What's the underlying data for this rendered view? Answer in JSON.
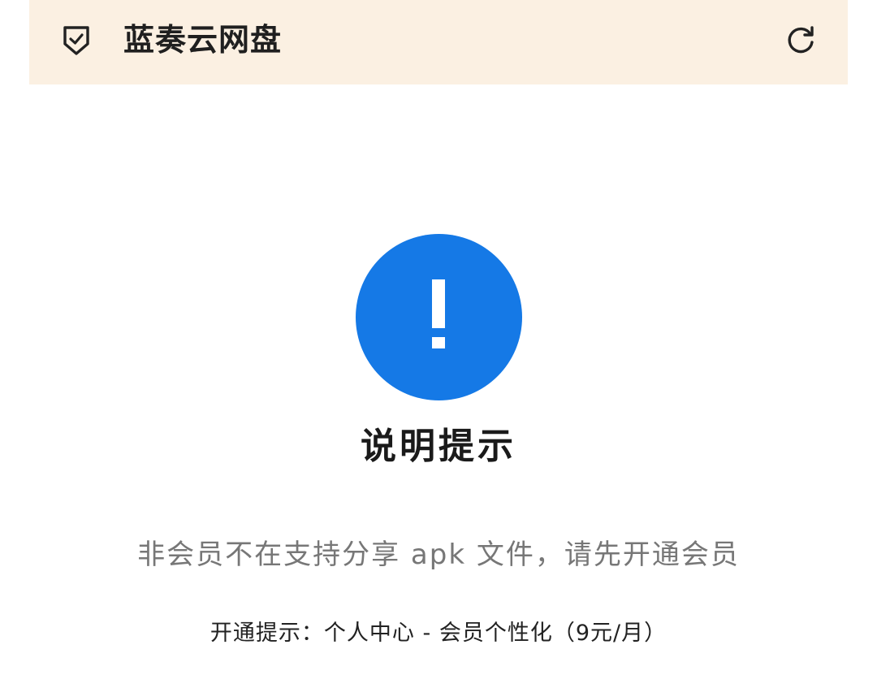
{
  "header": {
    "title": "蓝奏云网盘",
    "left_icon": "shield-check-icon",
    "right_icon": "refresh-icon",
    "background": "#fbf0e2"
  },
  "alert": {
    "icon": "exclamation-circle-icon",
    "icon_color": "#1579e6",
    "title": "说明提示",
    "message": "非会员不在支持分享 apk 文件，请先开通会员",
    "hint": "开通提示：个人中心 - 会员个性化（9元/月）"
  }
}
